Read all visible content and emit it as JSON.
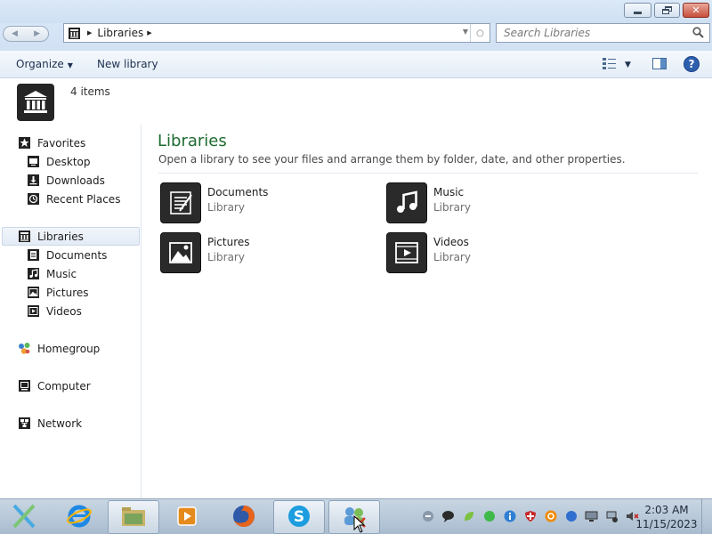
{
  "window": {
    "minimize_icon": "minimize-icon",
    "maximize_icon": "restore-icon",
    "close_icon": "close-icon"
  },
  "address": {
    "crumbs": [
      "Libraries"
    ],
    "search_placeholder": "Search Libraries"
  },
  "toolbar": {
    "organize_label": "Organize",
    "new_library_label": "New library"
  },
  "details": {
    "item_count": "4 items"
  },
  "sidebar": {
    "favorites": {
      "label": "Favorites",
      "items": [
        {
          "label": "Desktop",
          "icon": "desktop-icon"
        },
        {
          "label": "Downloads",
          "icon": "downloads-icon"
        },
        {
          "label": "Recent Places",
          "icon": "recent-places-icon"
        }
      ]
    },
    "libraries": {
      "label": "Libraries",
      "items": [
        {
          "label": "Documents",
          "icon": "documents-icon"
        },
        {
          "label": "Music",
          "icon": "music-icon"
        },
        {
          "label": "Pictures",
          "icon": "pictures-icon"
        },
        {
          "label": "Videos",
          "icon": "videos-icon"
        }
      ]
    },
    "homegroup": {
      "label": "Homegroup"
    },
    "computer": {
      "label": "Computer"
    },
    "network": {
      "label": "Network"
    }
  },
  "main": {
    "title": "Libraries",
    "subtitle": "Open a library to see your files and arrange them by folder, date, and other properties.",
    "libraries": [
      {
        "name": "Documents",
        "type": "Library",
        "icon": "documents-icon"
      },
      {
        "name": "Music",
        "type": "Library",
        "icon": "music-icon"
      },
      {
        "name": "Pictures",
        "type": "Library",
        "icon": "pictures-icon"
      },
      {
        "name": "Videos",
        "type": "Library",
        "icon": "videos-icon"
      }
    ]
  },
  "taskbar": {
    "pinned": [
      "start-icon",
      "internet-explorer-icon",
      "explorer-icon",
      "media-player-icon",
      "firefox-icon",
      "skype-icon",
      "network-users-icon"
    ],
    "clock_time": "2:03 AM",
    "clock_date": "11/15/2023"
  },
  "colors": {
    "title_green": "#1e6b30",
    "titlebar": "#d5e4f5",
    "close_red": "#c74f3c",
    "taskbar": "#b9c9d9"
  }
}
